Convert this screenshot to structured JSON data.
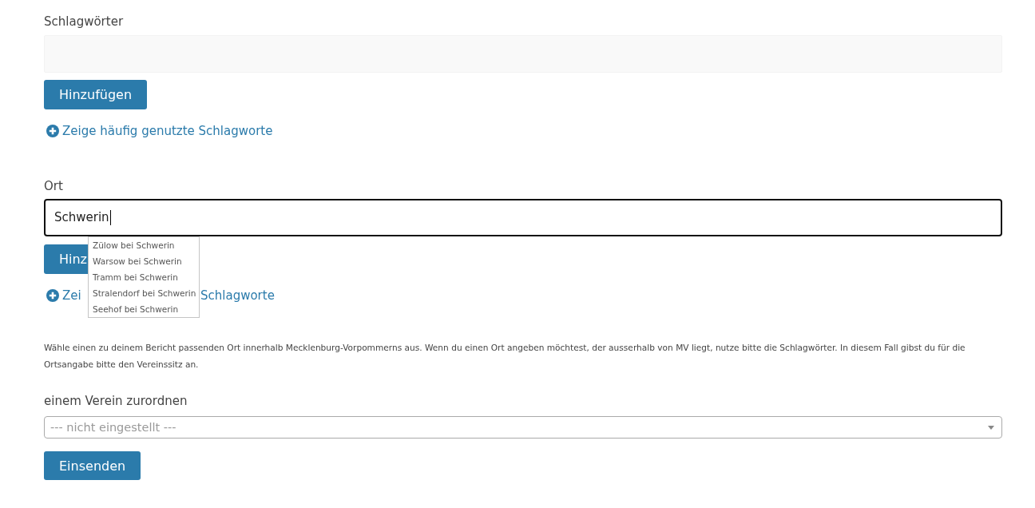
{
  "keywords": {
    "label": "Schlagwörter",
    "add_button": "Hinzufügen",
    "frequent_link": "Zeige häufig genutzte Schlagworte"
  },
  "location": {
    "label": "Ort",
    "input": {
      "value": "Schwerin",
      "focused": true
    },
    "suggestions": [
      {
        "label": "Zülow bei Schwerin",
        "selected": false
      },
      {
        "label": "Warsow bei Schwerin",
        "selected": false
      },
      {
        "label": "Tramm bei Schwerin",
        "selected": false
      },
      {
        "label": "Stralendorf bei Schwerin",
        "selected": false
      },
      {
        "label": "Seehof bei Schwerin",
        "selected": false
      }
    ],
    "add_button": "Hinz",
    "frequent_link": {
      "visible_start": "Zei",
      "visible_end": "Schlagworte"
    },
    "help_text": "Wähle einen zu deinem Bericht passenden Ort innerhalb Mecklenburg-Vorpommerns aus. Wenn du einen Ort angeben möchtest, der ausserhalb von MV liegt, nutze bitte die Schlagwörter. In diesem Fall gibst du für die Ortsangabe bitte den Vereinssitz an."
  },
  "club": {
    "label": "einem Verein zurordnen",
    "select": {
      "placeholder": "--- nicht eingestellt ---"
    }
  },
  "submit_button": "Einsenden"
}
